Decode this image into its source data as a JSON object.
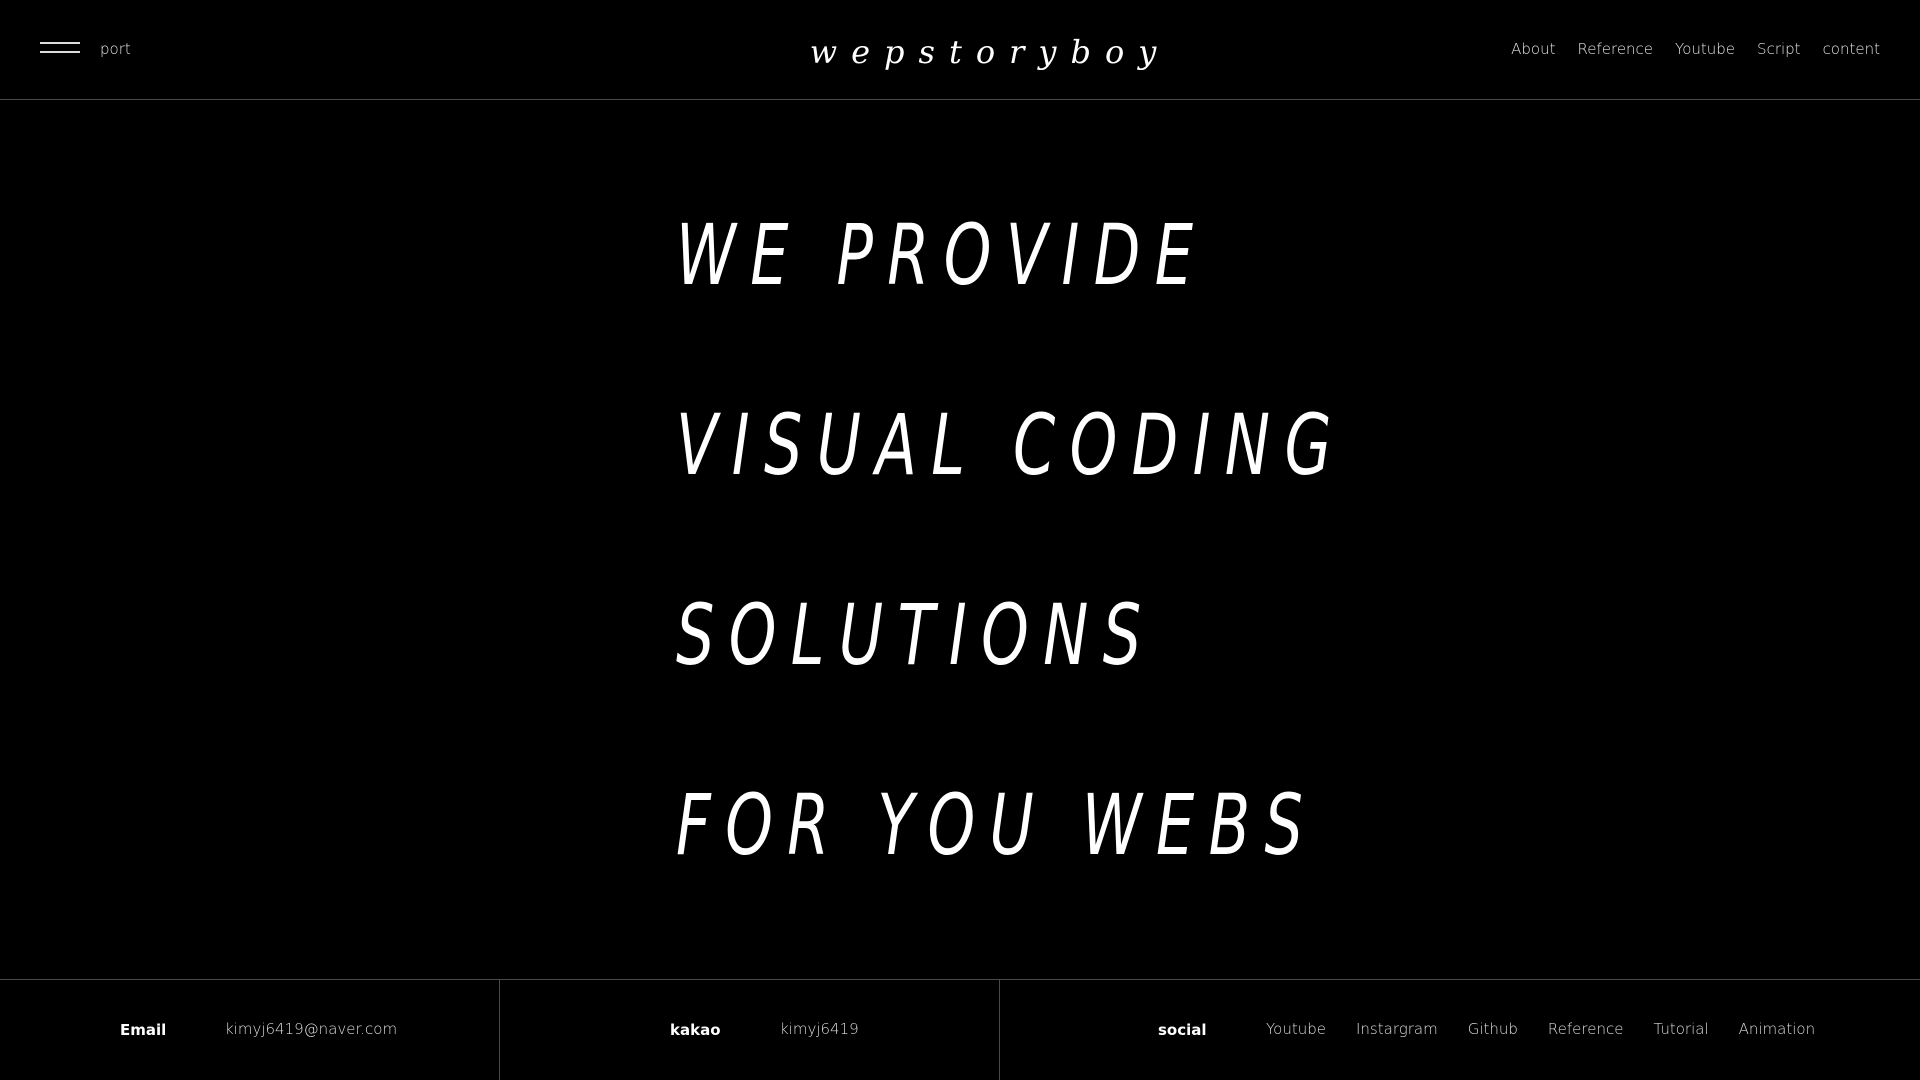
{
  "header": {
    "brand_sub": "port",
    "logo": "wepstoryboy",
    "nav": [
      "About",
      "Reference",
      "Youtube",
      "Script",
      "content"
    ]
  },
  "hero": {
    "lines": [
      "WE PROVIDE",
      "VISUAL CODING",
      "SOLUTIONS",
      "FOR YOU WEBS"
    ]
  },
  "footer": {
    "email": {
      "label": "Email",
      "value": "kimyj6419@naver.com"
    },
    "kakao": {
      "label": "kakao",
      "value": "kimyj6419"
    },
    "social": {
      "label": "social",
      "links": [
        "Youtube",
        "Instargram",
        "Github",
        "Reference",
        "Tutorial",
        "Animation"
      ]
    }
  }
}
